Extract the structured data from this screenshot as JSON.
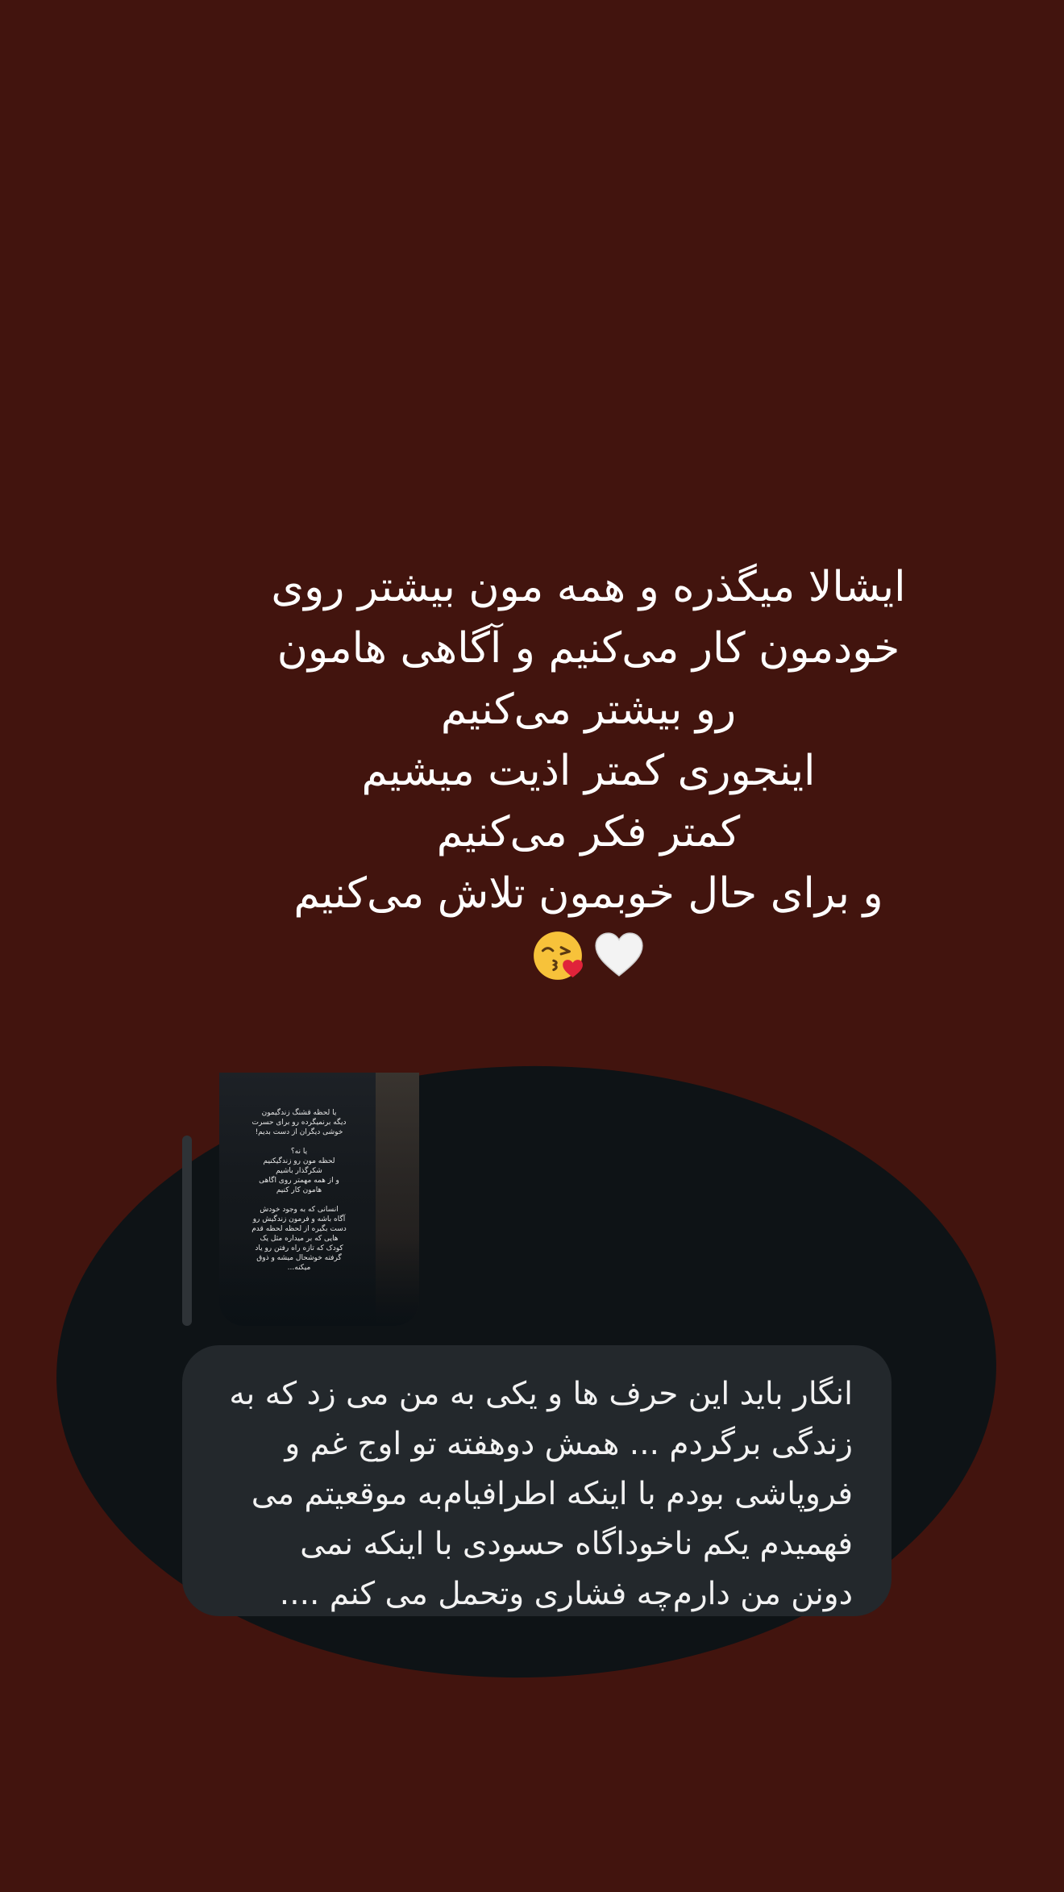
{
  "caption": {
    "lines": [
      "ایشالا میگذره و همه مون بیشتر روی",
      "خودمون کار می‌کنیم و آگاهی هامون",
      "رو بیشتر می‌کنیم",
      "اینجوری کمتر اذیت میشیم",
      "کمتر فکر می‌کنیم",
      "و برای حال خوبمون تلاش می‌کنیم"
    ],
    "emojis": [
      "white-heart-icon",
      "kissing-face-icon"
    ]
  },
  "story_preview": {
    "text": "یا لحظه قشنگ زندگیمون\nدیگه برنمیگرده رو برای حسرت\nخوشی دیگران از دست بدیم!\n\nیا نه؟\nلحظه مون رو زندگیکنیم\nشکرگذار باشیم\nو از همه مهمتر روی اگاهی\nهامون کار کنیم\n\nانسانی که به وجود خودش\nآگاه باشه و فرمون زندگیش رو\nدست بگیره از لحظه لحظه قدم\nهایی که بر میداره مثل یک\nکودک که تازه راه رفتن رو یاد\nگرفته خوشحال میشه و ذوق\nمیکنه..."
  },
  "reply_message": {
    "lines": [
      "انگار باید این حرف ها و یکی به من می زد که به",
      "زندگی برگردم ... همش دوهفته تو اوج غم و",
      "فروپاشی بودم با اینکه اطرافیام‌به موقعیتم می",
      "فهمیدم یکم ناخوداگاه حسودی با اینکه نمی",
      "دونن من دارم‌چه فشاری وتحمل می کنم ...."
    ]
  },
  "colors": {
    "background": "#42140e",
    "oval": "#0e1316",
    "bubble": "#23282c",
    "text": "#ffffff"
  }
}
